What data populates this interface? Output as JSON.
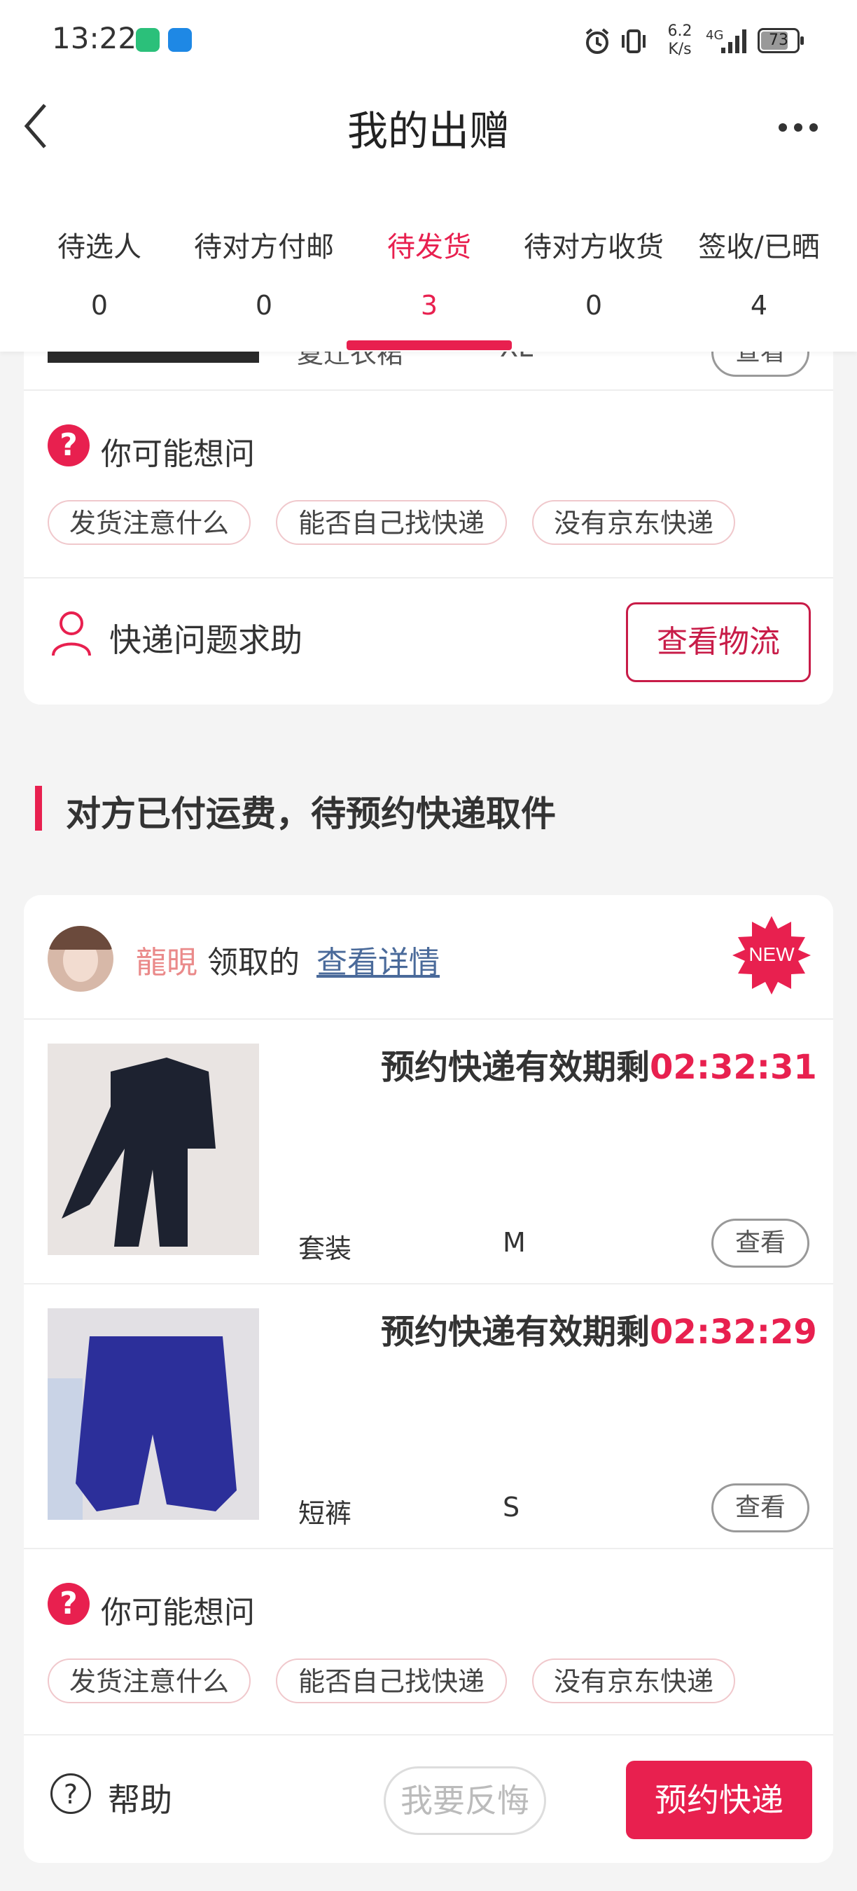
{
  "status_bar": {
    "time": "13:22",
    "net_speed_top": "6.2",
    "net_speed_bottom": "K/s",
    "network": "4G",
    "battery": "73"
  },
  "header": {
    "title": "我的出赠",
    "back_icon": "chevron-left-icon",
    "more_icon": "more-dots-icon"
  },
  "tabs": [
    {
      "label": "待选人",
      "count": "0"
    },
    {
      "label": "待对方付邮",
      "count": "0"
    },
    {
      "label": "待发货",
      "count": "3",
      "active": true
    },
    {
      "label": "待对方收货",
      "count": "0"
    },
    {
      "label": "签收/已晒",
      "count": "4"
    }
  ],
  "card1": {
    "item_name_partial": "夏迁衣裙",
    "item_size_partial": "XL",
    "view_label": "查看",
    "faq_title": "你可能想问",
    "chips": [
      "发货注意什么",
      "能否自己找快递",
      "没有京东快递"
    ],
    "help_label": "快递问题求助",
    "track_button": "查看物流"
  },
  "section": {
    "title": "对方已付运费，待预约快递取件"
  },
  "card2": {
    "user_name": "龍晛",
    "claim_text": "领取的",
    "detail_link": "查看详情",
    "badge": "NEW",
    "items": [
      {
        "countdown_label": "预约快递有效期剩",
        "countdown_time": "02:32:31",
        "name": "套装",
        "size": "M",
        "view_label": "查看"
      },
      {
        "countdown_label": "预约快递有效期剩",
        "countdown_time": "02:32:29",
        "name": "短裤",
        "size": "S",
        "view_label": "查看"
      }
    ],
    "faq_title": "你可能想问",
    "chips": [
      "发货注意什么",
      "能否自己找快递",
      "没有京东快递"
    ],
    "help_label": "帮助",
    "regret_button": "我要反悔",
    "book_button": "预约快递"
  },
  "colors": {
    "accent": "#e8204f",
    "accent_dark": "#c81c48",
    "background": "#f4f4f4"
  }
}
